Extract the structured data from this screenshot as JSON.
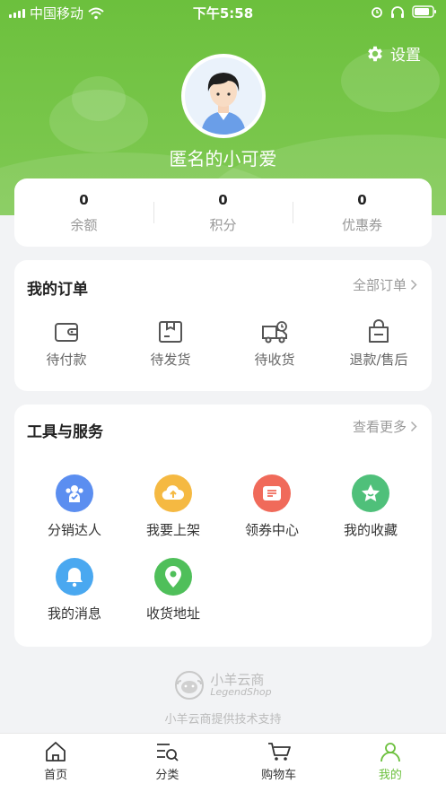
{
  "status_bar": {
    "carrier": "中国移动",
    "time": "下午5:58"
  },
  "header": {
    "settings_label": "设置",
    "username": "匿名的小可爱"
  },
  "colors": {
    "brand_green": "#6cc03d"
  },
  "stats": [
    {
      "value": "0",
      "label": "余额"
    },
    {
      "value": "0",
      "label": "积分"
    },
    {
      "value": "0",
      "label": "优惠券"
    }
  ],
  "orders": {
    "title": "我的订单",
    "more": "全部订单",
    "items": [
      {
        "label": "待付款",
        "icon": "wallet-icon"
      },
      {
        "label": "待发货",
        "icon": "package-icon"
      },
      {
        "label": "待收货",
        "icon": "delivery-truck-icon"
      },
      {
        "label": "退款/售后",
        "icon": "refund-bag-icon"
      }
    ]
  },
  "tools": {
    "title": "工具与服务",
    "more": "查看更多",
    "items": [
      {
        "label": "分销达人",
        "icon": "distributor-icon",
        "color": "#5b8ef0"
      },
      {
        "label": "我要上架",
        "icon": "upload-cloud-icon",
        "color": "#f5b942"
      },
      {
        "label": "领券中心",
        "icon": "coupon-icon",
        "color": "#f06a5a"
      },
      {
        "label": "我的收藏",
        "icon": "star-icon",
        "color": "#4fc07a"
      },
      {
        "label": "我的消息",
        "icon": "bell-icon",
        "color": "#4aa8f0"
      },
      {
        "label": "收货地址",
        "icon": "location-pin-icon",
        "color": "#4fbf5a"
      }
    ]
  },
  "footer": {
    "brand_cn": "小羊云商",
    "brand_en": "LegendShop",
    "support": "小羊云商提供技术支持"
  },
  "tabbar": [
    {
      "label": "首页",
      "icon": "home-icon",
      "active": false
    },
    {
      "label": "分类",
      "icon": "category-icon",
      "active": false
    },
    {
      "label": "购物车",
      "icon": "cart-icon",
      "active": false
    },
    {
      "label": "我的",
      "icon": "profile-icon",
      "active": true
    }
  ]
}
